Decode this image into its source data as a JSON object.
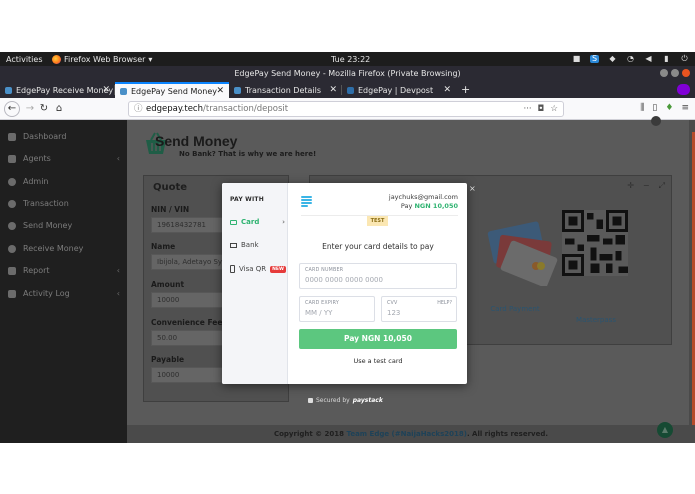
{
  "system": {
    "activities": "Activities",
    "app_name": "Firefox Web Browser",
    "clock": "Tue 23:22"
  },
  "window": {
    "title": "EdgePay Send Money - Mozilla Firefox (Private Browsing)"
  },
  "tabs": [
    {
      "label": "EdgePay Receive Money"
    },
    {
      "label": "EdgePay Send Money"
    },
    {
      "label": "Transaction Details"
    },
    {
      "label": "EdgePay | Devpost"
    }
  ],
  "url": {
    "host": "edgepay.tech",
    "path": "/transaction/deposit"
  },
  "sidebar": {
    "items": [
      {
        "label": "Dashboard"
      },
      {
        "label": "Agents",
        "chevron": "‹"
      },
      {
        "label": "Admin"
      },
      {
        "label": "Transaction"
      },
      {
        "label": "Send Money"
      },
      {
        "label": "Receive Money"
      },
      {
        "label": "Report",
        "chevron": "‹"
      },
      {
        "label": "Activity Log",
        "chevron": "‹"
      }
    ]
  },
  "page": {
    "title": "Send Money",
    "subtitle": "No Bank? That is why we are here!"
  },
  "quote": {
    "title": "Quote",
    "fields": [
      {
        "label": "NIN / VIN",
        "value": "19618432781"
      },
      {
        "label": "Name",
        "value": "Ibijola, Adetayo Sylv"
      },
      {
        "label": "Amount",
        "value": "10000"
      },
      {
        "label": "Convenience Fee",
        "value": "50.00"
      },
      {
        "label": "Payable",
        "value": "10000"
      }
    ]
  },
  "payment_options": {
    "cards_label": "Card Payment",
    "qr_label": "Masterpass"
  },
  "footer": {
    "prefix": "Copyright © 2018",
    "team": "Team Edge (#NaijaHacks2018)",
    "suffix": ". All rights reserved."
  },
  "modal": {
    "pay_with": "PAY WITH",
    "methods": [
      {
        "label": "Card"
      },
      {
        "label": "Bank"
      },
      {
        "label": "Visa QR",
        "badge": "NEW"
      }
    ],
    "email": "jaychuks@gmail.com",
    "pay_prefix": "Pay",
    "pay_amount": "NGN 10,050",
    "test_badge": "TEST",
    "instruction": "Enter your card details to pay",
    "card_number_label": "CARD NUMBER",
    "card_number_placeholder": "0000 0000 0000 0000",
    "expiry_label": "CARD EXPIRY",
    "expiry_placeholder": "MM / YY",
    "cvv_label": "CVV",
    "cvv_help": "HELP?",
    "cvv_placeholder": "123",
    "pay_button": "Pay NGN 10,050",
    "test_card_link": "Use a test card",
    "close": "×"
  },
  "secured": {
    "prefix": "Secured by",
    "brand": "paystack"
  }
}
